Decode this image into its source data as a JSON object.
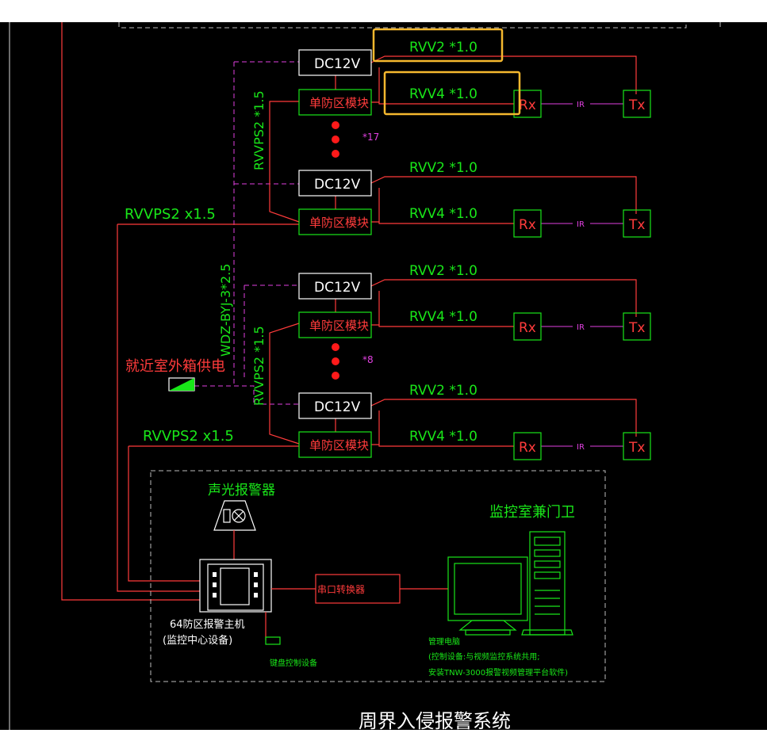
{
  "colors": {
    "background": "#000000",
    "green": "#19e619",
    "red": "#ff3b3b",
    "magenta": "#e040e0",
    "white": "#ffffff",
    "highlight": "#f5b82e",
    "dot": "#ff1a1a"
  },
  "title": "周界入侵报警系统",
  "power_note": "就近室外箱供电",
  "power_cable": "WDZ-BYJ-3*2.5",
  "groups": [
    {
      "trunk_label": "RVVPS2 *1.5",
      "feed_label": "RVVPS2 x1.5",
      "count_label": "*17",
      "rows": [
        {
          "dc": "DC12V",
          "module": "单防区模块",
          "power_cable": "RVV2 *1.0",
          "signal_cable": "RVV4 *1.0",
          "rx": "Rx",
          "ir": "IR",
          "tx": "Tx",
          "highlight": true
        },
        {
          "dc": "DC12V",
          "module": "单防区模块",
          "power_cable": "RVV2 *1.0",
          "signal_cable": "RVV4 *1.0",
          "rx": "Rx",
          "ir": "IR",
          "tx": "Tx",
          "highlight": false
        }
      ]
    },
    {
      "trunk_label": "RVVPS2 *1.5",
      "feed_label": "RVVPS2 x1.5",
      "count_label": "*8",
      "rows": [
        {
          "dc": "DC12V",
          "module": "单防区模块",
          "power_cable": "RVV2 *1.0",
          "signal_cable": "RVV4 *1.0",
          "rx": "Rx",
          "ir": "IR",
          "tx": "Tx",
          "highlight": false
        },
        {
          "dc": "DC12V",
          "module": "单防区模块",
          "power_cable": "RVV2 *1.0",
          "signal_cable": "RVV4 *1.0",
          "rx": "Rx",
          "ir": "IR",
          "tx": "Tx",
          "highlight": false
        }
      ]
    }
  ],
  "control_room": {
    "title": "监控室兼门卫",
    "alarm_label": "声光报警器",
    "host_label_1": "64防区报警主机",
    "host_label_2": "(监控中心设备)",
    "converter_label": "串口转换器",
    "keypad_label": "键盘控制设备",
    "pc_label_1": "管理电脑",
    "pc_label_2": "(控制设备:与视频监控系统共用;",
    "pc_label_3": "安装TNW-3000报警视频管理平台软件)"
  }
}
